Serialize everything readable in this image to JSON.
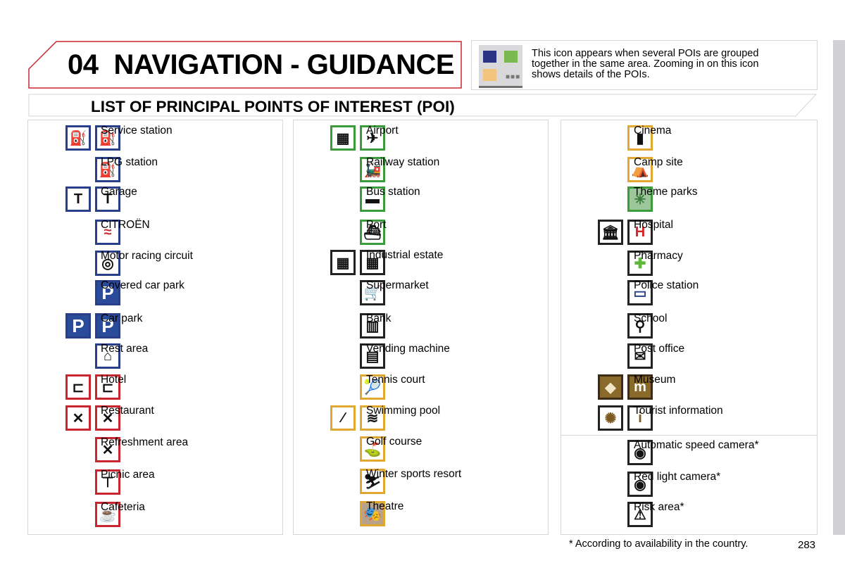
{
  "header": {
    "chapter_number": "04",
    "chapter_title": "NAVIGATION - GUIDANCE",
    "accent_color": "#c8252e"
  },
  "cluster_note": {
    "icon": "poi-cluster-icon",
    "text": "This icon appears when several POIs are grouped together in the same area. Zooming in on this icon shows details of the POIs.",
    "colors": [
      "#2a3486",
      "#79b94d",
      "#f2c47c"
    ]
  },
  "section_title": "LIST OF PRINCIPAL POINTS OF INTEREST (POI)",
  "columns": [
    {
      "items": [
        {
          "label": "Service station",
          "icons": [
            "fuel-pump-icon",
            "fuel-pump-icon"
          ],
          "color": "blue"
        },
        {
          "label": "LPG station",
          "icons": [
            "lpg-pump-icon"
          ],
          "color": "blue"
        },
        {
          "label": "Garage",
          "icons": [
            "wrench-icon",
            "wrench-icon"
          ],
          "color": "blue"
        },
        {
          "label": "CITROËN",
          "icons": [
            "citroen-logo-icon"
          ],
          "color": "blue"
        },
        {
          "label": "Motor racing circuit",
          "icons": [
            "race-circuit-icon"
          ],
          "color": "blue"
        },
        {
          "label": "Covered car park",
          "icons": [
            "covered-parking-icon"
          ],
          "color": "blue"
        },
        {
          "label": "Car park",
          "icons": [
            "parking-icon",
            "parking-icon"
          ],
          "color": "blue"
        },
        {
          "label": "Rest area",
          "icons": [
            "rest-area-icon"
          ],
          "color": "blue"
        },
        {
          "label": "Hotel",
          "icons": [
            "bed-icon",
            "bed-icon"
          ],
          "color": "red"
        },
        {
          "label": "Restaurant",
          "icons": [
            "cutlery-icon",
            "cutlery-icon"
          ],
          "color": "red"
        },
        {
          "label": "Refreshment area",
          "icons": [
            "refreshment-icon"
          ],
          "color": "red"
        },
        {
          "label": "Picnic area",
          "icons": [
            "picnic-icon"
          ],
          "color": "red"
        },
        {
          "label": "Cafeteria",
          "icons": [
            "coffee-cup-icon"
          ],
          "color": "red"
        }
      ]
    },
    {
      "items": [
        {
          "label": "Airport",
          "icons": [
            "transport-group-icon",
            "airplane-icon"
          ],
          "color": "green"
        },
        {
          "label": "Railway station",
          "icons": [
            "train-icon"
          ],
          "color": "green"
        },
        {
          "label": "Bus station",
          "icons": [
            "bus-icon"
          ],
          "color": "green"
        },
        {
          "label": "Port",
          "icons": [
            "ship-icon"
          ],
          "color": "green"
        },
        {
          "label": "Industrial estate",
          "icons": [
            "industrial-group-icon",
            "industrial-group-icon"
          ],
          "color": "black"
        },
        {
          "label": "Supermarket",
          "icons": [
            "shopping-cart-icon"
          ],
          "color": "black"
        },
        {
          "label": "Bank",
          "icons": [
            "bank-icon"
          ],
          "color": "black"
        },
        {
          "label": "Vending machine",
          "icons": [
            "atm-icon"
          ],
          "color": "black"
        },
        {
          "label": "Tennis court",
          "icons": [
            "tennis-icon"
          ],
          "color": "gold"
        },
        {
          "label": "Swimming pool",
          "icons": [
            "leisure-group-icon",
            "swimmer-icon"
          ],
          "color": "gold"
        },
        {
          "label": "Golf course",
          "icons": [
            "golf-icon"
          ],
          "color": "gold"
        },
        {
          "label": "Winter sports resort",
          "icons": [
            "ski-icon"
          ],
          "color": "gold"
        },
        {
          "label": "Theatre",
          "icons": [
            "theatre-icon"
          ],
          "color": "gold"
        }
      ]
    },
    {
      "items": [
        {
          "label": "Cinema",
          "icons": [
            "film-icon"
          ],
          "color": "gold"
        },
        {
          "label": "Camp site",
          "icons": [
            "camping-icon"
          ],
          "color": "gold"
        },
        {
          "label": "Theme parks",
          "icons": [
            "ferris-wheel-icon"
          ],
          "color": "green"
        },
        {
          "label": "Hospital",
          "icons": [
            "public-building-icon",
            "hospital-h-icon"
          ],
          "color": "black"
        },
        {
          "label": "Pharmacy",
          "icons": [
            "pharmacy-cross-icon"
          ],
          "color": "black"
        },
        {
          "label": "Police station",
          "icons": [
            "police-icon"
          ],
          "color": "black"
        },
        {
          "label": "School",
          "icons": [
            "school-children-icon"
          ],
          "color": "black"
        },
        {
          "label": "Post office",
          "icons": [
            "envelope-icon"
          ],
          "color": "black"
        },
        {
          "label": "Museum",
          "icons": [
            "monument-icon",
            "museum-m-icon"
          ],
          "color": "brown"
        },
        {
          "label": "Tourist information",
          "icons": [
            "tourism-icon",
            "info-i-icon"
          ],
          "color": "black"
        },
        {
          "label": "Automatic speed camera*",
          "icons": [
            "speed-camera-icon"
          ],
          "color": "black"
        },
        {
          "label": "Red light camera*",
          "icons": [
            "red-light-camera-icon"
          ],
          "color": "black"
        },
        {
          "label": "Risk area*",
          "icons": [
            "risk-area-icon"
          ],
          "color": "black"
        }
      ]
    }
  ],
  "footnote": "* According to availability in the country.",
  "page_number": "283"
}
